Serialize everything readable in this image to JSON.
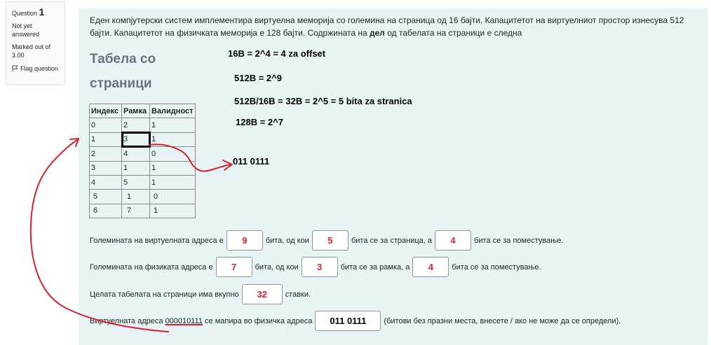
{
  "info": {
    "question_label": "Question",
    "question_number": "1",
    "status": "Not yet answered",
    "marked_label": "Marked out of 3.00",
    "flag_label": "Flag question"
  },
  "question": {
    "line1": "Еден компјутерски систем имплементира виртуелна меморија со големина на страница од 16 бајти.  Капацитетот на виртуелниот простор изнесува 512",
    "line2_a": "бајти.  Капацитетот на физичката меморија е 128 бајти. Содржината на ",
    "line2_bold": "дел",
    "line2_b": " од табелата на страници е следна"
  },
  "heading": {
    "line1": "Табела со",
    "line2": "страници"
  },
  "table": {
    "headers": [
      "Индекс",
      "Рамка",
      "Валидност"
    ],
    "rows": [
      [
        "0",
        "2",
        "1"
      ],
      [
        "1",
        "3",
        "1"
      ],
      [
        "2",
        "4",
        "0"
      ],
      [
        "3",
        "1",
        "1"
      ],
      [
        "4",
        "5",
        "1"
      ],
      [
        "5",
        "1",
        "0"
      ],
      [
        "6",
        "7",
        "1"
      ]
    ]
  },
  "notes": {
    "n1": "16B = 2^4 = 4 za offset",
    "n2": "512B = 2^9",
    "n3": "512B/16B = 32B = 2^5 = 5 bita za stranica",
    "n4": "128B = 2^7",
    "n5": "011 0111"
  },
  "rows": {
    "r1": {
      "a": "Големината на виртуелната адреса е",
      "v1": "9",
      "b": "бита, од кои",
      "v2": "5",
      "c": "бита се за страница, а",
      "v3": "4",
      "d": "бита се за поместување."
    },
    "r2": {
      "a": "Големината на физиката адреса е",
      "v1": "7",
      "b": "бита, од кои",
      "v2": "3",
      "c": "бита се за рамка, а",
      "v3": "4",
      "d": "бита се за поместување."
    },
    "r3": {
      "a": "Целата табелата на страници има вкупно",
      "v1": "32",
      "b": "ставки."
    },
    "r4": {
      "a": "Виртуелната адреса ",
      "addr": "000010111",
      "b": " се мапира во физичка адреса",
      "v1": "011 0111",
      "c": "(битови без празни места, внесете / ако не може да се определи)."
    }
  },
  "colors": {
    "annotation": "#d9232e",
    "panel": "#e7f3f5"
  }
}
